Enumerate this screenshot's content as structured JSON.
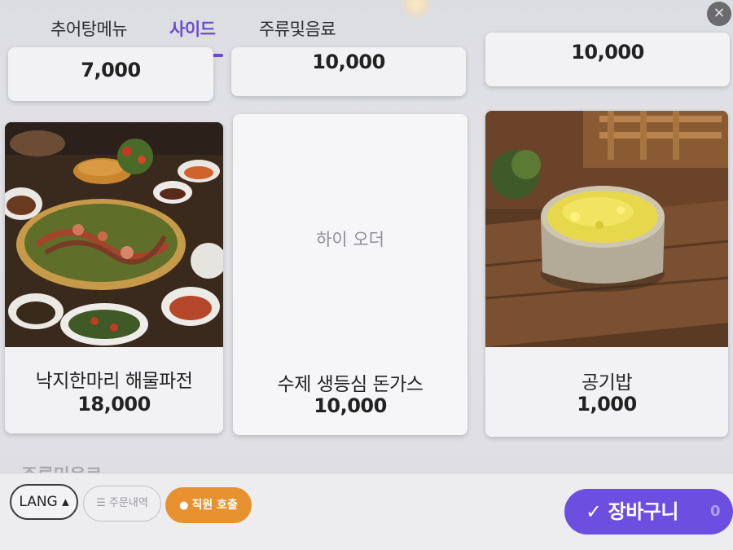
{
  "header": {
    "tabs": [
      {
        "label": "추어탕메뉴",
        "active": false
      },
      {
        "label": "사이드",
        "active": true
      },
      {
        "label": "주류및음료",
        "active": false
      }
    ],
    "close_icon": "×"
  },
  "top_row_prices": [
    "7,000",
    "10,000",
    "10,000"
  ],
  "menu": [
    {
      "name": "낙지한마리 해물파전",
      "price": "18,000",
      "image": "seafood-pancake-photo"
    },
    {
      "name": "수제 생등심 돈가스",
      "price": "10,000",
      "image": "placeholder",
      "placeholder": "하이 오더"
    },
    {
      "name": "공기밥",
      "price": "1,000",
      "image": "rice-bowl-photo"
    }
  ],
  "next_section": "주류및음료",
  "bottom": {
    "lang": "LANG ▴",
    "orders": "☰ 주문내역",
    "staff": "직원 호출",
    "cart": "장바구니",
    "cart_count": "0"
  },
  "colors": {
    "accent": "#6a4bd9",
    "staff": "#e8922f",
    "cart": "#6c4fe0"
  }
}
